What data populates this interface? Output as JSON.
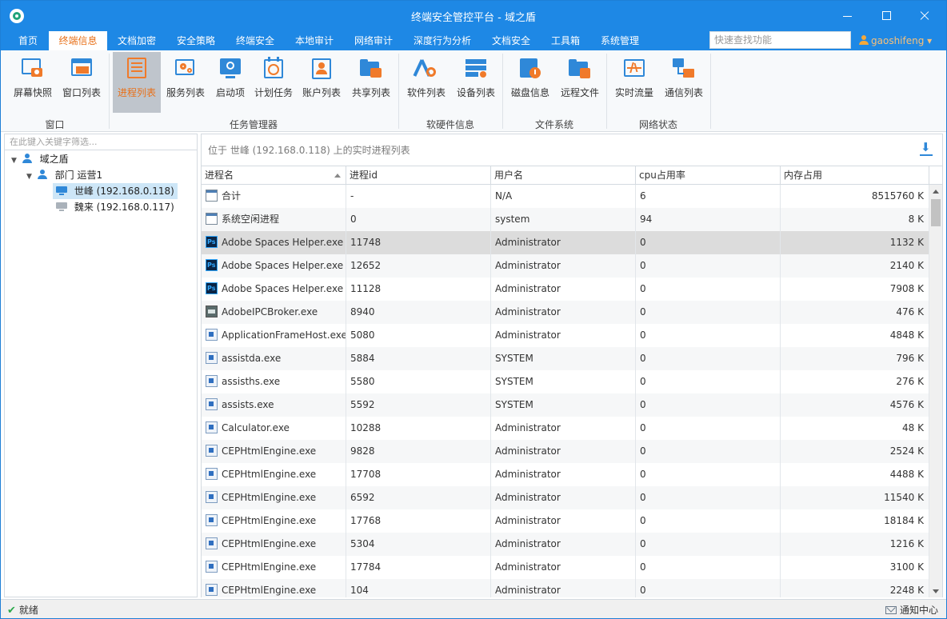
{
  "window": {
    "title": "终端安全管控平台 - 域之盾"
  },
  "menu": {
    "items": [
      "首页",
      "终端信息",
      "文档加密",
      "安全策略",
      "终端安全",
      "本地审计",
      "网络审计",
      "深度行为分析",
      "文档安全",
      "工具箱",
      "系统管理"
    ],
    "active_index": 1,
    "search_placeholder": "快速查找功能",
    "user": "gaoshifeng ▾"
  },
  "ribbon": {
    "buttons": [
      {
        "label": "屏幕快照",
        "icon": "screenshot-icon"
      },
      {
        "label": "窗口列表",
        "icon": "window-list-icon"
      },
      {
        "label": "进程列表",
        "icon": "process-list-icon",
        "active": true
      },
      {
        "label": "服务列表",
        "icon": "service-list-icon"
      },
      {
        "label": "启动项",
        "icon": "startup-icon"
      },
      {
        "label": "计划任务",
        "icon": "scheduled-task-icon"
      },
      {
        "label": "账户列表",
        "icon": "account-list-icon"
      },
      {
        "label": "共享列表",
        "icon": "share-list-icon"
      },
      {
        "label": "软件列表",
        "icon": "software-list-icon"
      },
      {
        "label": "设备列表",
        "icon": "device-list-icon"
      },
      {
        "label": "磁盘信息",
        "icon": "disk-info-icon"
      },
      {
        "label": "远程文件",
        "icon": "remote-file-icon"
      },
      {
        "label": "实时流量",
        "icon": "realtime-traffic-icon"
      },
      {
        "label": "通信列表",
        "icon": "connection-list-icon"
      }
    ],
    "groups": [
      "窗口",
      "任务管理器",
      "软硬件信息",
      "文件系统",
      "网络状态"
    ]
  },
  "tree": {
    "filter_placeholder": "在此键入关键字筛选...",
    "root": "域之盾",
    "department": "部门 运营1",
    "computers": [
      {
        "label": "世峰 (192.168.0.118)",
        "online": true,
        "selected": true
      },
      {
        "label": "魏来 (192.168.0.117)",
        "online": false,
        "selected": false
      }
    ]
  },
  "main": {
    "location_text": "位于 世峰 (192.168.0.118) 上的实时进程列表",
    "columns": [
      "进程名",
      "进程id",
      "用户名",
      "cpu占用率",
      "内存占用"
    ],
    "rows": [
      {
        "icon": "app",
        "name": "合计",
        "pid": "-",
        "user": "N/A",
        "cpu": "6",
        "mem": "8515760 K"
      },
      {
        "icon": "app",
        "name": "系统空闲进程",
        "pid": "0",
        "user": "system",
        "cpu": "94",
        "mem": "8 K"
      },
      {
        "icon": "ps",
        "name": "Adobe Spaces Helper.exe",
        "pid": "11748",
        "user": "Administrator",
        "cpu": "0",
        "mem": "1132 K",
        "selected": true
      },
      {
        "icon": "ps",
        "name": "Adobe Spaces Helper.exe",
        "pid": "12652",
        "user": "Administrator",
        "cpu": "0",
        "mem": "2140 K"
      },
      {
        "icon": "ps",
        "name": "Adobe Spaces Helper.exe",
        "pid": "11128",
        "user": "Administrator",
        "cpu": "0",
        "mem": "7908 K"
      },
      {
        "icon": "broker",
        "name": "AdobeIPCBroker.exe",
        "pid": "8940",
        "user": "Administrator",
        "cpu": "0",
        "mem": "476 K"
      },
      {
        "icon": "exe",
        "name": "ApplicationFrameHost.exe",
        "pid": "5080",
        "user": "Administrator",
        "cpu": "0",
        "mem": "4848 K"
      },
      {
        "icon": "exe",
        "name": "assistda.exe",
        "pid": "5884",
        "user": "SYSTEM",
        "cpu": "0",
        "mem": "796 K"
      },
      {
        "icon": "exe",
        "name": "assisths.exe",
        "pid": "5580",
        "user": "SYSTEM",
        "cpu": "0",
        "mem": "276 K"
      },
      {
        "icon": "exe",
        "name": "assists.exe",
        "pid": "5592",
        "user": "SYSTEM",
        "cpu": "0",
        "mem": "4576 K"
      },
      {
        "icon": "exe",
        "name": "Calculator.exe",
        "pid": "10288",
        "user": "Administrator",
        "cpu": "0",
        "mem": "48 K"
      },
      {
        "icon": "exe",
        "name": "CEPHtmlEngine.exe",
        "pid": "9828",
        "user": "Administrator",
        "cpu": "0",
        "mem": "2524 K"
      },
      {
        "icon": "exe",
        "name": "CEPHtmlEngine.exe",
        "pid": "17708",
        "user": "Administrator",
        "cpu": "0",
        "mem": "4488 K"
      },
      {
        "icon": "exe",
        "name": "CEPHtmlEngine.exe",
        "pid": "6592",
        "user": "Administrator",
        "cpu": "0",
        "mem": "11540 K"
      },
      {
        "icon": "exe",
        "name": "CEPHtmlEngine.exe",
        "pid": "17768",
        "user": "Administrator",
        "cpu": "0",
        "mem": "18184 K"
      },
      {
        "icon": "exe",
        "name": "CEPHtmlEngine.exe",
        "pid": "5304",
        "user": "Administrator",
        "cpu": "0",
        "mem": "1216 K"
      },
      {
        "icon": "exe",
        "name": "CEPHtmlEngine.exe",
        "pid": "17784",
        "user": "Administrator",
        "cpu": "0",
        "mem": "3100 K"
      },
      {
        "icon": "exe",
        "name": "CEPHtmlEngine.exe",
        "pid": "104",
        "user": "Administrator",
        "cpu": "0",
        "mem": "2248 K"
      }
    ]
  },
  "status": {
    "left": "就绪",
    "right": "通知中心"
  },
  "colors": {
    "accent": "#1e88e5",
    "active_text": "#e8711a"
  }
}
